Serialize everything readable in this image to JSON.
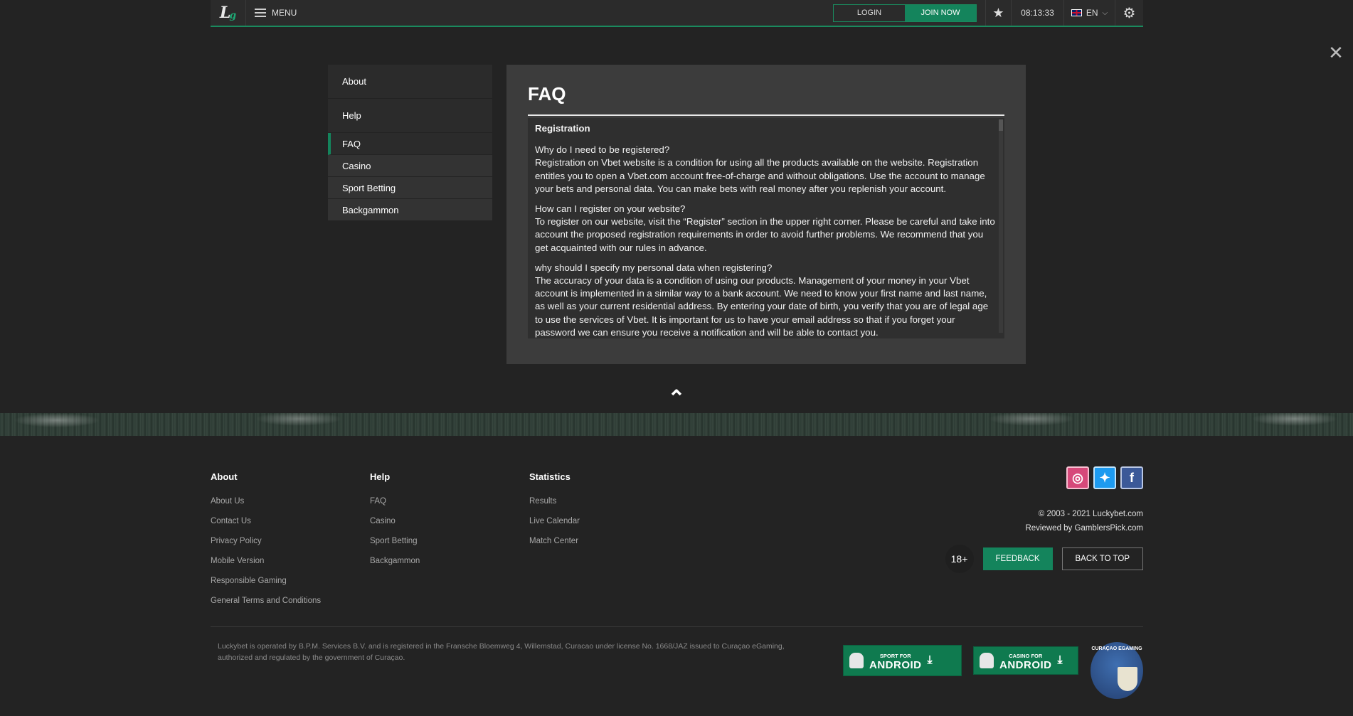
{
  "topbar": {
    "logo": "L",
    "logo_sub": "g",
    "menu_label": "MENU",
    "login_label": "LOGIN",
    "join_label": "JOIN NOW",
    "time": "08:13:33",
    "language": "EN"
  },
  "sidebar": {
    "items": [
      {
        "label": "About"
      },
      {
        "label": "Help"
      },
      {
        "label": "FAQ"
      },
      {
        "label": "Casino"
      },
      {
        "label": "Sport Betting"
      },
      {
        "label": "Backgammon"
      }
    ]
  },
  "content": {
    "title": "FAQ",
    "section": "Registration",
    "qa": [
      {
        "q": "Why do I need to be registered?",
        "a": "Registration on Vbet website is a condition for using all the products available on the website. Registration entitles you to open a Vbet.com account free-of-charge and without obligations. Use the account to manage your bets and personal data. You can make bets with real money after you replenish your account."
      },
      {
        "q": "How can I register on your website?",
        "a": "To register on our website, visit the “Register” section in the upper right corner. Please be careful and take into account the proposed registration requirements in order to avoid further problems. We recommend that you get acquainted with our rules in advance."
      },
      {
        "q": "why should I specify my personal data when registering?",
        "a": "The accuracy of your data is a condition of using our products. Management of your money in your Vbet account is implemented in a similar way to a bank account. We need to know your first name and last name, as well as your current residential address. By entering your date of birth, you verify that you are of legal age to use the services of Vbet. It is important for us to have your email address so that if you forget your password we can ensure you receive a notification and will be able to contact you."
      }
    ]
  },
  "footer": {
    "columns": [
      {
        "title": "About",
        "links": [
          "About Us",
          "Contact Us",
          "Privacy Policy",
          "Mobile Version",
          "Responsible Gaming",
          "General Terms and Conditions"
        ]
      },
      {
        "title": "Help",
        "links": [
          "FAQ",
          "Casino",
          "Sport Betting",
          "Backgammon"
        ]
      },
      {
        "title": "Statistics",
        "links": [
          "Results",
          "Live Calendar",
          "Match Center"
        ]
      }
    ],
    "copyright": "© 2003 - 2021 Luckybet.com",
    "reviewed": "Reviewed by GamblersPick.com",
    "age": "18+",
    "feedback_label": "FEEDBACK",
    "back_to_top_label": "BACK TO TOP",
    "legal": "Luckybet is operated by B.P.M. Services B.V. and is registered in the Fransche Bloemweg 4, Willemstad, Curacao under license No. 1668/JAZ issued to Curaçao eGaming, authorized and regulated by the government of Curaçao.",
    "apps": [
      {
        "small": "SPORT FOR",
        "big": "ANDROID"
      },
      {
        "small": "CASINO FOR",
        "big": "ANDROID"
      }
    ],
    "seal_label": "CURAÇAO EGAMING",
    "social": {
      "instagram": "instagram-icon",
      "twitter": "twitter-icon",
      "facebook": "facebook-icon"
    }
  },
  "colors": {
    "accent": "#14845c",
    "background": "#232323",
    "panel": "#3c3c3c"
  }
}
